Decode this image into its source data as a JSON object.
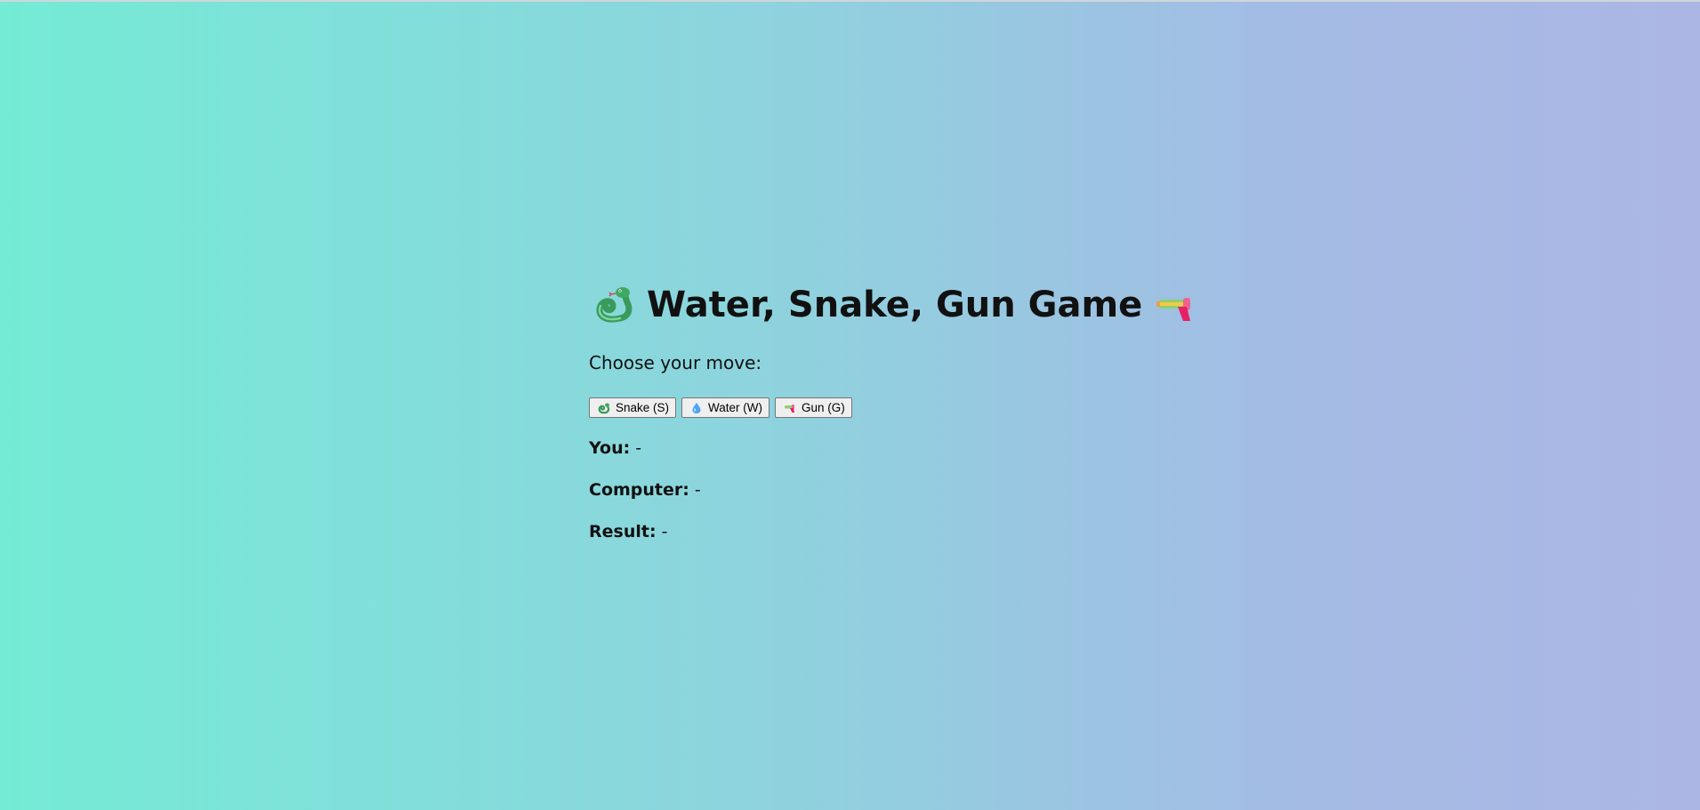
{
  "page": {
    "title": "Water, Snake, Gun Game",
    "title_icons": [
      "snake-icon",
      "water-gun-icon"
    ],
    "prompt": "Choose your move:"
  },
  "moves": [
    {
      "label": "Snake (S)",
      "icon": "snake-icon"
    },
    {
      "label": "Water (W)",
      "icon": "water-drop-icon"
    },
    {
      "label": "Gun (G)",
      "icon": "water-gun-icon"
    }
  ],
  "stats": {
    "you_label": "You:",
    "you_value": "-",
    "computer_label": "Computer:",
    "computer_value": "-",
    "result_label": "Result:",
    "result_value": "-"
  },
  "colors": {
    "gradient_start": "#74ebd5",
    "gradient_end": "#acb6e5"
  }
}
